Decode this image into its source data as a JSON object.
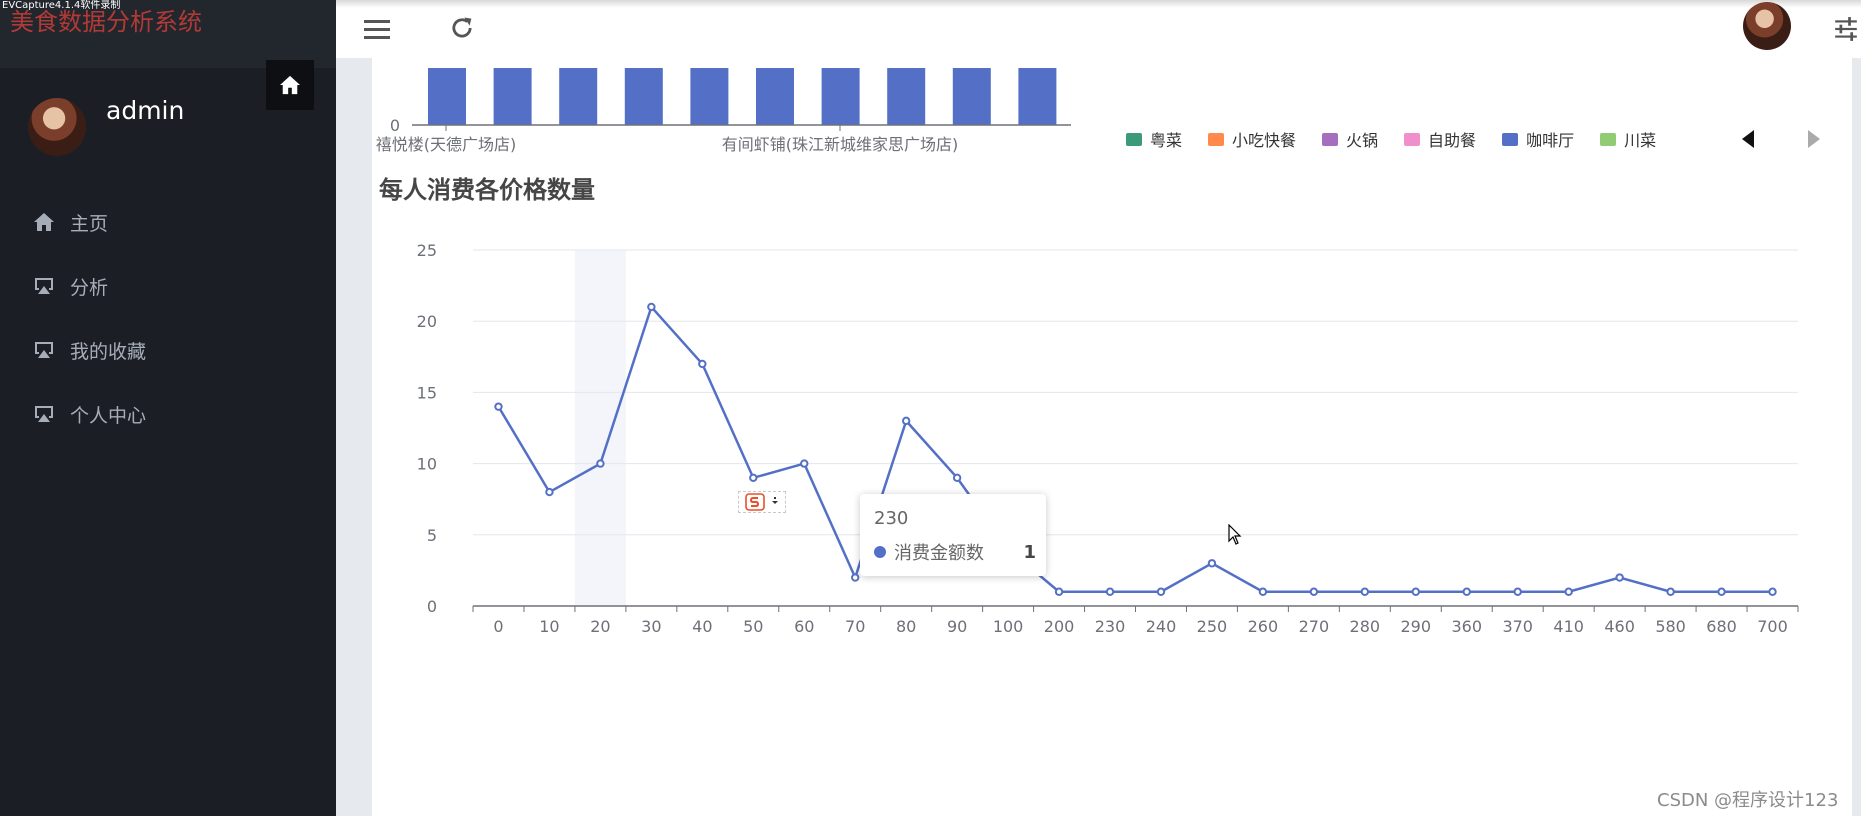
{
  "recorder": {
    "label": "EVCapture4.1.4软件录制"
  },
  "sidebar": {
    "app_title": "美食数据分析系统",
    "user_name": "admin",
    "items": [
      {
        "label": "主页",
        "icon": "home-icon"
      },
      {
        "label": "分析",
        "icon": "monitor-icon"
      },
      {
        "label": "我的收藏",
        "icon": "monitor-icon"
      },
      {
        "label": "个人中心",
        "icon": "monitor-icon"
      }
    ]
  },
  "header": {
    "icons": [
      "menu-icon",
      "refresh-icon",
      "avatar",
      "settings-sliders-icon"
    ]
  },
  "top_chart": {
    "type": "bar",
    "y_tick": "0",
    "x_labels": [
      "禧悦楼(天德广场店)",
      "有间虾铺(珠江新城维家思广场店)"
    ],
    "bar_color": "#5470c6",
    "legend": [
      {
        "label": "粤菜",
        "color": "#3b9a79"
      },
      {
        "label": "小吃快餐",
        "color": "#ff8a4c"
      },
      {
        "label": "火锅",
        "color": "#a66fbd"
      },
      {
        "label": "自助餐",
        "color": "#f08fc9"
      },
      {
        "label": "咖啡厅",
        "color": "#5470c6"
      },
      {
        "label": "川菜",
        "color": "#91cc75"
      }
    ]
  },
  "chart_data": {
    "type": "line",
    "title": "每人消费各价格数量",
    "x": [
      "0",
      "10",
      "20",
      "30",
      "40",
      "50",
      "60",
      "70",
      "80",
      "90",
      "100",
      "200",
      "230",
      "240",
      "250",
      "260",
      "270",
      "280",
      "290",
      "360",
      "370",
      "410",
      "460",
      "580",
      "680",
      "700"
    ],
    "series": [
      {
        "name": "消费金额数",
        "values": [
          14,
          8,
          10,
          21,
          17,
          9,
          10,
          2,
          13,
          9,
          4,
          1,
          1,
          1,
          3,
          1,
          1,
          1,
          1,
          1,
          1,
          1,
          2,
          1,
          1,
          1
        ]
      }
    ],
    "ylim": [
      0,
      25
    ],
    "yticks": [
      "0",
      "5",
      "10",
      "15",
      "20",
      "25"
    ],
    "grid": true,
    "line_color": "#5470c6",
    "highlight_category": "20"
  },
  "tooltip": {
    "title": "230",
    "series_name": "消费金额数",
    "value": "1"
  },
  "watermark": "CSDN @程序设计123"
}
